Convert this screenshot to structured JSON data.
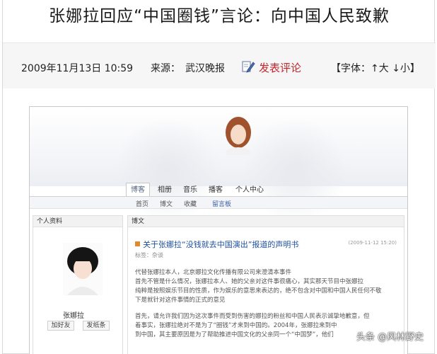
{
  "headline": "张娜拉回应“中国圈钱”言论：向中国人民致歉",
  "meta": {
    "date": "2009年11月13日 10:59",
    "source_label": "来源：",
    "source": "武汉晚报",
    "comment_link": "发表评论",
    "font_size_label": "【字体：",
    "font_large": "↑大",
    "font_small": "↓小",
    "font_close": "】"
  },
  "screenshot": {
    "tabs": [
      "博客",
      "相册",
      "音乐",
      "播客",
      "个人中心"
    ],
    "subtabs": [
      "首页",
      "博文",
      "收藏",
      "留言板"
    ],
    "left_panel": {
      "header": "个人资料",
      "name": "张娜拉",
      "buttons": [
        "加好友",
        "发纸条"
      ]
    },
    "main_panel": {
      "header": "博文",
      "title": "关于张娜拉“没钱就去中国演出”报道的声明书",
      "date": "(2009-11-12 15:20)",
      "tag": "标签：杂谈",
      "body": [
        "代替张娜拉本人，北京娜拉文化传播有限公司来澄清本事件",
        "首先不管是什么情况，张娜拉本人、她的父亲对这件事很痛心，其实那天节目中张娜拉",
        "纯粹是按照娱乐节目的性质，作为娱乐的意思来表达的，绝不包含对中国和中国人民任何不敬",
        "下是就针对这件事情的正式的意见",
        "首先，请允许我们因为这次事件而受到伤害的娜拉的粉丝和中国人民表示诚挚地歉意，但",
        "着事实，张娜拉绝对不是为了“圈钱”才来到中国的。2004年，张娜拉来到中",
        "到中国，其主要原因是为了帮助推进中国文化的父亲同一个“中国梦”，他们"
      ]
    }
  },
  "watermark": "头条 @风林野史"
}
